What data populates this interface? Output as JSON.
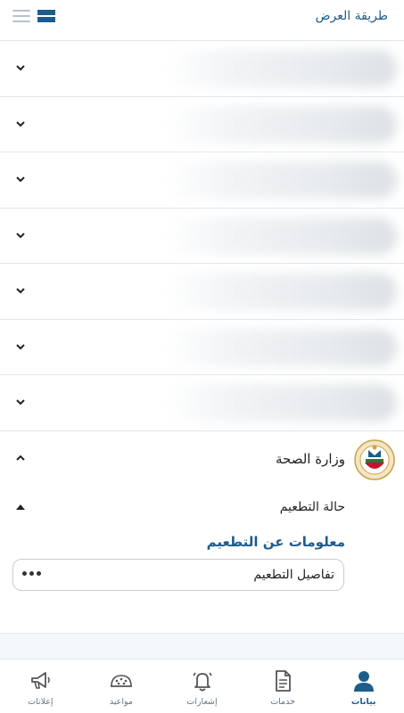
{
  "header": {
    "view_mode_label": "طريقة العرض"
  },
  "accordion": {
    "collapsed_count": 7
  },
  "ministry": {
    "name": "وزارة الصحة",
    "section_title": "حالة التطعيم",
    "info_heading": "معلومات عن التطعيم",
    "details_label": "تفاصيل التطعيم"
  },
  "bottom_nav": {
    "items": [
      {
        "label": "بيانات",
        "icon": "person-icon",
        "active": true
      },
      {
        "label": "خدمات",
        "icon": "document-icon",
        "active": false
      },
      {
        "label": "إشعارات",
        "icon": "bell-icon",
        "active": false
      },
      {
        "label": "مواعيد",
        "icon": "calendar-icon",
        "active": false
      },
      {
        "label": "إعلانات",
        "icon": "megaphone-icon",
        "active": false
      }
    ]
  },
  "colors": {
    "accent": "#1c5d8c",
    "inactive": "#6b7480"
  }
}
